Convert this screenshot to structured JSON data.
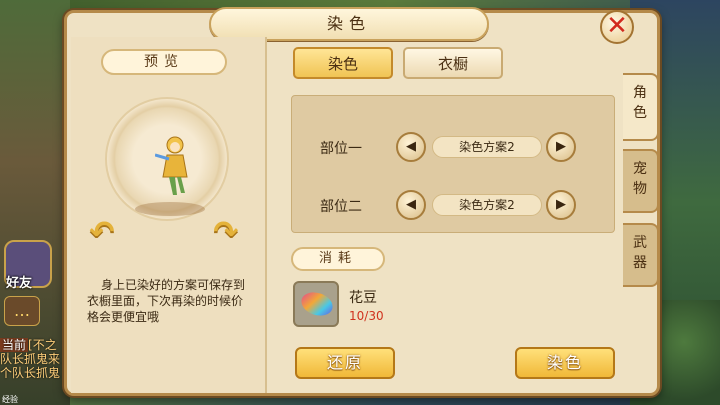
{
  "window": {
    "title": "染色"
  },
  "background": {
    "friend_label": "好友",
    "chat_icon": "…",
    "chat_lines": [
      {
        "tag": "当前",
        "text": "[不之"
      },
      {
        "tag": "",
        "text": "队长抓鬼来"
      },
      {
        "tag": "",
        "text": "个队长抓鬼"
      }
    ],
    "exp_label": "经验"
  },
  "preview": {
    "label": "预览",
    "rotate_left_icon": "↶",
    "rotate_right_icon": "↷",
    "description": "身上已染好的方案可保存到衣橱里面，下次再染的时候价格会更便宜哦"
  },
  "tabs": {
    "dye": "染色",
    "wardrobe": "衣橱"
  },
  "parts": [
    {
      "label": "部位一",
      "value": "染色方案2"
    },
    {
      "label": "部位二",
      "value": "染色方案2"
    }
  ],
  "arrows": {
    "left": "◀",
    "right": "▶"
  },
  "cost": {
    "label": "消耗",
    "item_name": "花豆",
    "count": "10/30"
  },
  "buttons": {
    "restore": "还原",
    "dye": "染色"
  },
  "side_tabs": [
    {
      "label": "角色"
    },
    {
      "label": "宠物"
    },
    {
      "label": "武器"
    }
  ],
  "close_icon": "✕"
}
